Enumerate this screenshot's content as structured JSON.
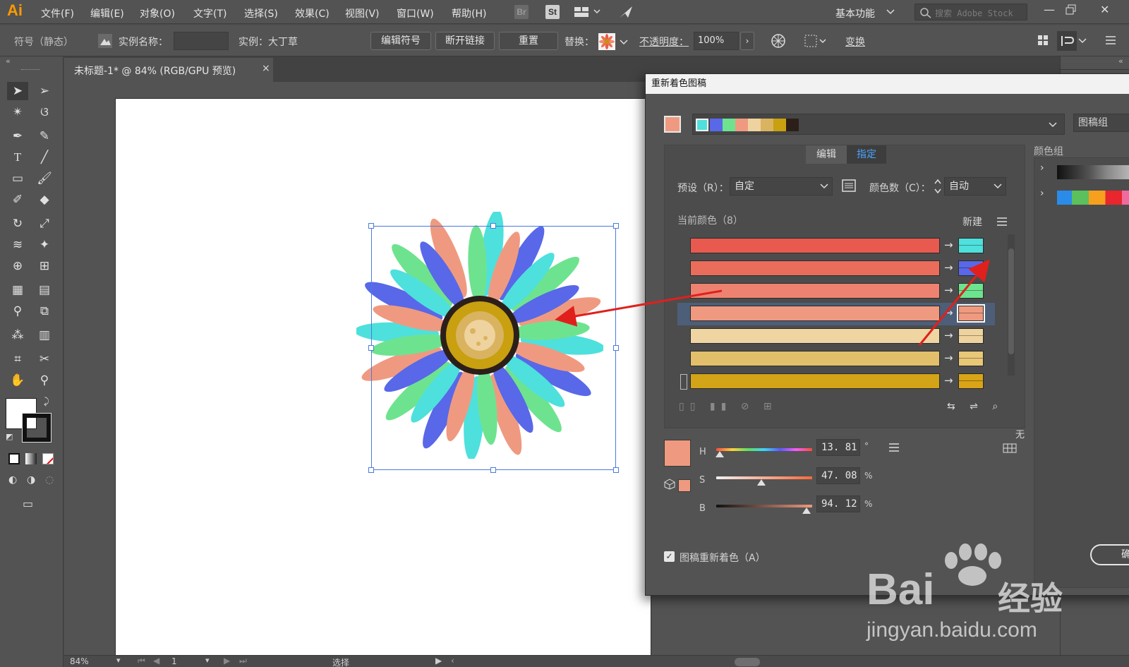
{
  "app": {
    "logo": "Ai"
  },
  "menu": [
    "文件(F)",
    "编辑(E)",
    "对象(O)",
    "文字(T)",
    "选择(S)",
    "效果(C)",
    "视图(V)",
    "窗口(W)",
    "帮助(H)"
  ],
  "menubar_icons": {
    "br": "Br",
    "st": "St"
  },
  "workspace": "基本功能",
  "search": {
    "placeholder": "搜索 Adobe Stock"
  },
  "control_bar": {
    "mode_label": "符号（静态）",
    "instance_name_label": "实例名称：",
    "instance_label": "实例：大丁草",
    "edit_symbol": "编辑符号",
    "break_link": "断开链接",
    "reset": "重置",
    "replace_label": "替换：",
    "opacity_label": "不透明度：",
    "opacity_value": "100%",
    "transform": "变换"
  },
  "document_tab": {
    "title": "未标题-1* @ 84% (RGB/GPU 预览)",
    "close": "×"
  },
  "status_bar": {
    "zoom": "84%",
    "page": "1",
    "tool": "选择"
  },
  "dialog": {
    "title": "重新着色图稿",
    "group_select_label": "图稿组",
    "tabs": {
      "edit": "编辑",
      "assign": "指定"
    },
    "preset_label": "预设（R）：",
    "preset_value": "自定",
    "color_count_label": "颜色数（C）：",
    "color_count_value": "自动",
    "current_colors_label": "当前颜色（8）",
    "new_label": "新建",
    "swatch_strip": [
      "#4ee0dc",
      "#5868e8",
      "#6ee38f",
      "#ef9a80",
      "#efd39e",
      "#d9b35f",
      "#c8a010",
      "#2c1f1a"
    ],
    "rows": [
      {
        "current": "#e85a4f",
        "new": "#4ee0dc"
      },
      {
        "current": "#ea6d5b",
        "new": "#5868e8"
      },
      {
        "current": "#ee8270",
        "new": "#6ee38f"
      },
      {
        "current": "#ef9a80",
        "new": "#ef9a80"
      },
      {
        "current": "#eed5a2",
        "new": "#efd39e"
      },
      {
        "current": "#e2bf6a",
        "new": "#e8c777"
      },
      {
        "current": "#d3a318",
        "new": "#d9a418"
      }
    ],
    "hsb": {
      "h_label": "H",
      "h_value": "13. 81",
      "h_unit": "°",
      "s_label": "S",
      "s_value": "47. 08",
      "s_unit": "%",
      "b_label": "B",
      "b_value": "94. 12",
      "b_unit": "%",
      "h_fraction": 0.038,
      "s_fraction": 0.47,
      "b_fraction": 0.94
    },
    "none_label": "无",
    "recolor_checkbox_label": "图稿重新着色（A）",
    "ok_button_partial": "确",
    "color_groups_label": "颜色组"
  },
  "watermark": {
    "brand": "Bai",
    "brand2": "经验",
    "url": "jingyan.baidu.com"
  }
}
